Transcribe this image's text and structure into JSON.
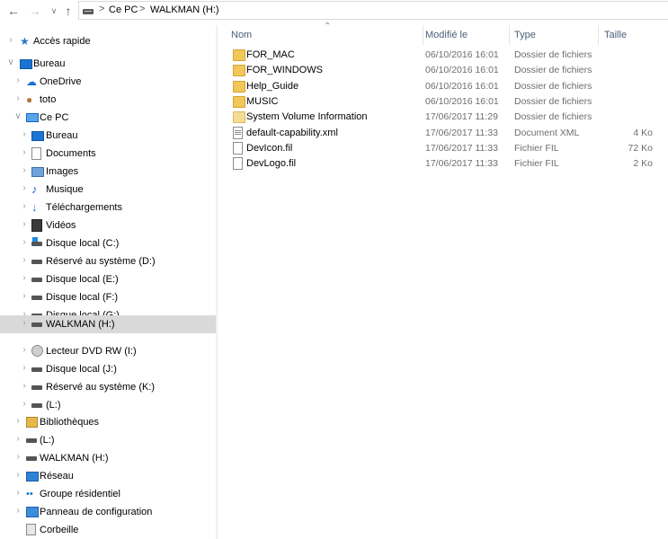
{
  "address_bar": {
    "back_icon": "arrow-left-icon",
    "forward_icon": "arrow-right-icon",
    "recent_icon": "chevron-down-icon",
    "up_icon": "arrow-up-icon",
    "crumbs": [
      "Ce PC",
      "WALKMAN (H:)"
    ],
    "separator": ">"
  },
  "nav_pane": {
    "items": [
      {
        "label": "Accès rapide",
        "icon": "star-icon",
        "chev": ">"
      },
      {
        "label": "Bureau",
        "icon": "desktop-icon",
        "chev": "v"
      },
      {
        "label": "OneDrive",
        "icon": "cloud-icon",
        "chev": ">"
      },
      {
        "label": "toto",
        "icon": "user-icon",
        "chev": ">"
      },
      {
        "label": "Ce PC",
        "icon": "computer-icon",
        "chev": "v"
      },
      {
        "label": "Bureau",
        "icon": "desktop-icon",
        "chev": ">"
      },
      {
        "label": "Documents",
        "icon": "document-icon",
        "chev": ">"
      },
      {
        "label": "Images",
        "icon": "image-icon",
        "chev": ">"
      },
      {
        "label": "Musique",
        "icon": "music-icon",
        "chev": ">"
      },
      {
        "label": "Téléchargements",
        "icon": "download-icon",
        "chev": ">"
      },
      {
        "label": "Vidéos",
        "icon": "video-icon",
        "chev": ">"
      },
      {
        "label": "Disque local (C:)",
        "icon": "windows-drive-icon",
        "chev": ">"
      },
      {
        "label": "Réservé au système (D:)",
        "icon": "drive-icon",
        "chev": ">"
      },
      {
        "label": "Disque local (E:)",
        "icon": "drive-icon",
        "chev": ">"
      },
      {
        "label": "Disque local (F:)",
        "icon": "drive-icon",
        "chev": ">"
      },
      {
        "label": "Disque local (G:)",
        "icon": "drive-icon",
        "chev": ">"
      },
      {
        "label": "WALKMAN (H:)",
        "icon": "drive-icon",
        "chev": ">",
        "selected": true
      },
      {
        "label": "Lecteur DVD RW (I:)",
        "icon": "dvd-drive-icon",
        "chev": ">"
      },
      {
        "label": "Disque local (J:)",
        "icon": "drive-icon",
        "chev": ">"
      },
      {
        "label": "Réservé au système (K:)",
        "icon": "drive-icon",
        "chev": ">"
      },
      {
        "label": "(L:)",
        "icon": "drive-icon",
        "chev": ">"
      },
      {
        "label": "Bibliothèques",
        "icon": "library-icon",
        "chev": ">"
      },
      {
        "label": "(L:)",
        "icon": "drive-icon",
        "chev": ">"
      },
      {
        "label": "WALKMAN (H:)",
        "icon": "drive-icon",
        "chev": ">"
      },
      {
        "label": "Réseau",
        "icon": "network-icon",
        "chev": ">"
      },
      {
        "label": "Groupe résidentiel",
        "icon": "homegroup-icon",
        "chev": ">"
      },
      {
        "label": "Panneau de configuration",
        "icon": "control-panel-icon",
        "chev": ">"
      },
      {
        "label": "Corbeille",
        "icon": "recycle-bin-icon",
        "chev": ""
      }
    ]
  },
  "columns": {
    "name": "Nom",
    "modified": "Modifié le",
    "type": "Type",
    "size": "Taille"
  },
  "files": [
    {
      "name": "FOR_MAC",
      "modified": "06/10/2016 16:01",
      "type": "Dossier de fichiers",
      "size": "",
      "icon": "folder-icon"
    },
    {
      "name": "FOR_WINDOWS",
      "modified": "06/10/2016 16:01",
      "type": "Dossier de fichiers",
      "size": "",
      "icon": "folder-icon"
    },
    {
      "name": "Help_Guide",
      "modified": "06/10/2016 16:01",
      "type": "Dossier de fichiers",
      "size": "",
      "icon": "folder-icon"
    },
    {
      "name": "MUSIC",
      "modified": "06/10/2016 16:01",
      "type": "Dossier de fichiers",
      "size": "",
      "icon": "folder-icon"
    },
    {
      "name": "System Volume Information",
      "modified": "17/06/2017 11:29",
      "type": "Dossier de fichiers",
      "size": "",
      "icon": "system-folder-icon"
    },
    {
      "name": "default-capability.xml",
      "modified": "17/06/2017 11:33",
      "type": "Document XML",
      "size": "4 Ko",
      "icon": "xml-file-icon"
    },
    {
      "name": "DevIcon.fil",
      "modified": "17/06/2017 11:33",
      "type": "Fichier FIL",
      "size": "72 Ko",
      "icon": "file-icon"
    },
    {
      "name": "DevLogo.fil",
      "modified": "17/06/2017 11:33",
      "type": "Fichier FIL",
      "size": "2 Ko",
      "icon": "file-icon"
    }
  ]
}
